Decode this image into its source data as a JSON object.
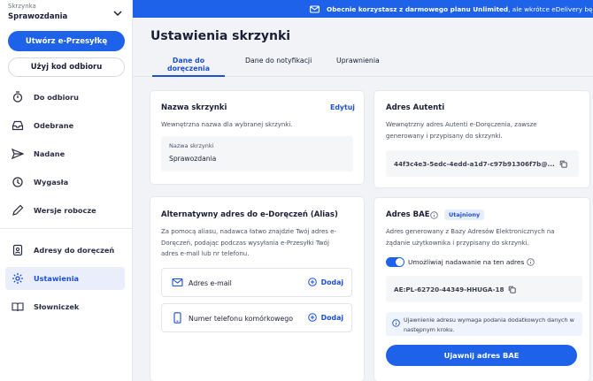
{
  "sidebar": {
    "mailbox_label": "Skrzynka",
    "mailbox_name": "Sprawozdania",
    "create_button": "Utwórz e-Przesyłkę",
    "code_button": "Użyj kod odbioru",
    "items": [
      {
        "label": "Do odbioru",
        "icon": "stopwatch-icon"
      },
      {
        "label": "Odebrane",
        "icon": "inbox-icon"
      },
      {
        "label": "Nadane",
        "icon": "send-icon"
      },
      {
        "label": "Wygasła",
        "icon": "expired-clock-icon"
      },
      {
        "label": "Wersje robocze",
        "icon": "pencil-icon"
      },
      {
        "label": "Adresy do doręczeń",
        "icon": "address-book-icon"
      },
      {
        "label": "Ustawienia",
        "icon": "gear-icon",
        "active": true
      },
      {
        "label": "Słowniczek",
        "icon": "book-icon"
      }
    ]
  },
  "banner": {
    "bold": "Obecnie korzystasz z darmowego planu Unlimited",
    "rest": ", ale wkrótce eDelivery będzie",
    "icon": "mail-icon"
  },
  "page": {
    "title": "Ustawienia skrzynki",
    "tabs": [
      "Dane do doręczenia",
      "Dane do notyfikacji",
      "Uprawnienia"
    ]
  },
  "name_card": {
    "title": "Nazwa skrzynki",
    "edit": "Edytuj",
    "desc": "Wewnętrzna nazwa dla wybranej skrzynki.",
    "field_label": "Nazwa skrzynki",
    "field_value": "Sprawozdania"
  },
  "alias_card": {
    "title": "Alternatywny adres do e-Doręczeń (Alias)",
    "desc": [
      "Za pomocą aliasu, nadawca łatwo znajdzie Twój adres e-",
      "Doręczeń, podając podczas wysyłania e-Przesyłki Twój",
      "adres e-mail lub nr telefonu."
    ],
    "email_label": "Adres e-mail",
    "phone_label": "Numer telefonu komórkowego",
    "add": "Dodaj"
  },
  "autenti_card": {
    "title": "Adres Autenti",
    "desc": [
      "Wewnętrzny adres Autenti e-Doręczenia, zawsze",
      "generowany i przypisany do skrzynki."
    ],
    "address": "44f3c4e3-5edc-4edd-a1d7-c97b91306f7b@..."
  },
  "bae_card": {
    "title": "Adres BAE",
    "badge": "Utajniony",
    "desc": [
      "Adres generowany z Bazy Adresów Elektronicznych na",
      "żądanie użytkownika i przypisany do skrzynki."
    ],
    "toggle_label": "Umożliwiaj nadawanie na ten adres",
    "toggle_on": true,
    "address": "AE:PL-62720-44349-HHUGA-18",
    "info": [
      "Ujawnienie adresu wymaga podania dodatkowych danych w",
      "następnym kroku."
    ],
    "reveal_button": "Ujawnij adres BAE"
  },
  "colors": {
    "accent": "#1d62e8",
    "active_bg": "#e9eefa",
    "badge_bg": "#e6eefc"
  }
}
